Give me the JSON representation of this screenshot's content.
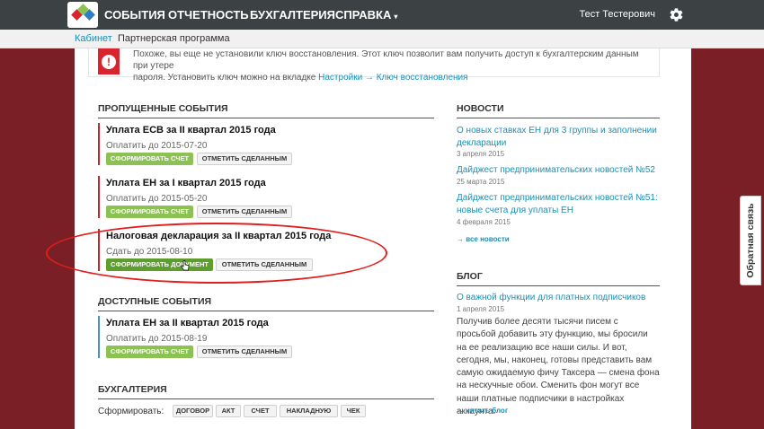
{
  "topbar": {
    "nav": [
      {
        "label": "СОБЫТИЯ"
      },
      {
        "label": "ОТЧЕТНОСТЬ"
      },
      {
        "label": "БУХГАЛТЕРИЯ"
      },
      {
        "label": "СПРАВКА"
      }
    ],
    "user_name": "Тест Тестерович"
  },
  "subnav": {
    "items": [
      {
        "label": "Кабинет"
      },
      {
        "label": "Партнерская программа"
      }
    ]
  },
  "alert": {
    "line1": "Похоже, вы еще не установили ключ восстановления. Этот ключ позволит вам получить доступ к бухгалтерским данным при утере",
    "line2_prefix": "пароля. Установить ключ можно на вкладке ",
    "line2_link": "Настройки → Ключ восстановления"
  },
  "missed": {
    "heading": "ПРОПУЩЕННЫЕ СОБЫТИЯ",
    "events": [
      {
        "title": "Уплата ЕСВ за II квартал 2015 года",
        "due": "Оплатить до 2015-07-20",
        "primary": "СФОРМИРОВАТЬ СЧЕТ",
        "secondary": "ОТМЕТИТЬ СДЕЛАННЫМ"
      },
      {
        "title": "Уплата ЕН за I квартал 2015 года",
        "due": "Оплатить до 2015-05-20",
        "primary": "СФОРМИРОВАТЬ СЧЕТ",
        "secondary": "ОТМЕТИТЬ СДЕЛАННЫМ"
      },
      {
        "title": "Налоговая декларация за II квартал 2015 года",
        "due": "Сдать до 2015-08-10",
        "primary": "СФОРМИРОВАТЬ ДОКУМЕНТ",
        "secondary": "ОТМЕТИТЬ СДЕЛАННЫМ"
      }
    ]
  },
  "available": {
    "heading": "ДОСТУПНЫЕ СОБЫТИЯ",
    "events": [
      {
        "title": "Уплата ЕН за II квартал 2015 года",
        "due": "Оплатить до 2015-08-19",
        "primary": "СФОРМИРОВАТЬ СЧЕТ",
        "secondary": "ОТМЕТИТЬ СДЕЛАННЫМ"
      }
    ]
  },
  "accounting": {
    "heading": "БУХГАЛТЕРИЯ",
    "form_label": "Сформировать:",
    "buttons": [
      "ДОГОВОР",
      "АКТ",
      "СЧЕТ",
      "НАКЛАДНУЮ",
      "ЧЕК"
    ]
  },
  "news": {
    "heading": "НОВОСТИ",
    "items": [
      {
        "title": "О новых ставках ЕН для 3 группы и заполнении декларации",
        "date": "3 апреля 2015"
      },
      {
        "title": "Дайджест предпринимательских новостей №52",
        "date": "25 марта 2015"
      },
      {
        "title": "Дайджест предпринимательских новостей №51: новые счета для уплаты ЕН",
        "date": "4 февраля 2015"
      }
    ],
    "more": "→ все новости"
  },
  "blog": {
    "heading": "БЛОГ",
    "title": "О важной функции для платных подписчиков",
    "date": "1 апреля 2015",
    "text": "Получив более десяти тысячи писем с просьбой добавить эту функцию, мы бросили на ее реализацию все наши силы. И вот, сегодня, мы, наконец, готовы представить вам самую ожидаемую фичу Таксера — смена фона на нескучные обои. Сменить фон могут все наши платные подписчики в настройках аккаунта.",
    "more": "→ читать блог"
  },
  "feedback": {
    "label": "Обратная связь"
  },
  "colors": {
    "accent": "#1a8fb5",
    "green": "#8cc153",
    "missed": "#c7252d",
    "available": "#4a90c8",
    "annotation": "#e11d1d"
  }
}
